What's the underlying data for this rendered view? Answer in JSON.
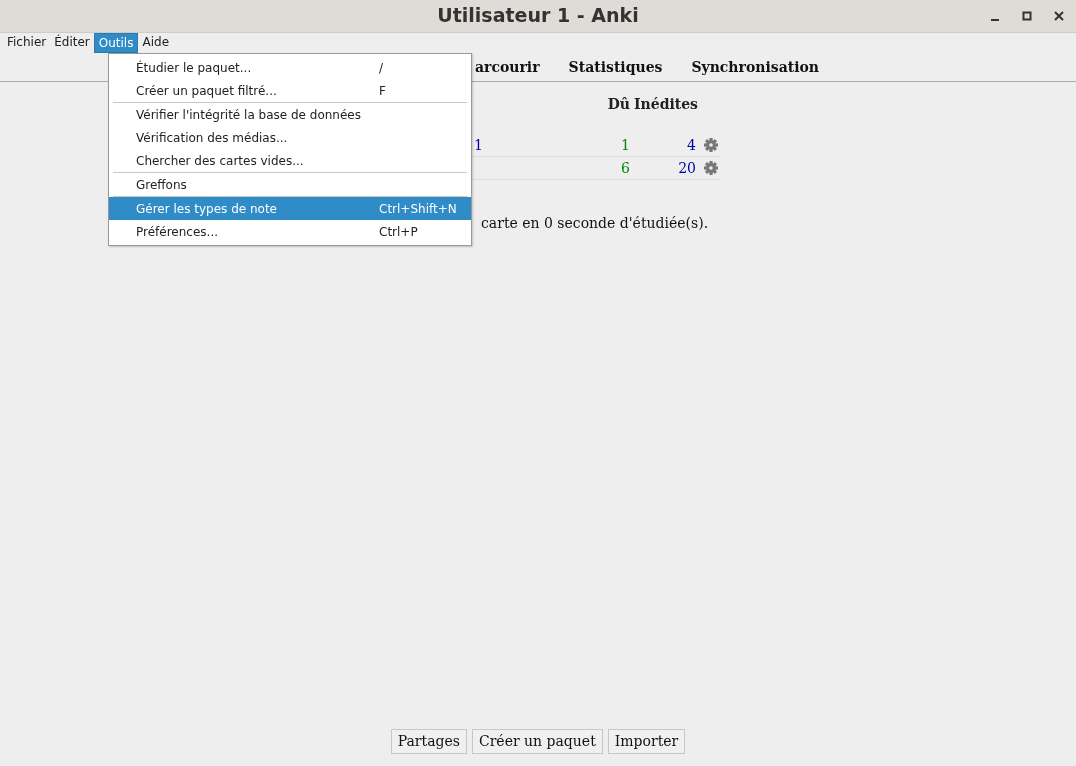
{
  "window": {
    "title": "Utilisateur 1 - Anki"
  },
  "menubar": [
    {
      "label": "Fichier",
      "selected": false
    },
    {
      "label": "Éditer",
      "selected": false
    },
    {
      "label": "Outils",
      "selected": true
    },
    {
      "label": "Aide",
      "selected": false
    }
  ],
  "menu": [
    {
      "kind": "item",
      "label": "Étudier le paquet...",
      "shortcut": "/",
      "selected": false
    },
    {
      "kind": "item",
      "label": "Créer un paquet filtré...",
      "shortcut": "F",
      "selected": false
    },
    {
      "kind": "separator"
    },
    {
      "kind": "item",
      "label": "Vérifier l'intégrité la base de données",
      "selected": false
    },
    {
      "kind": "item",
      "label": "Vérification des médias...",
      "selected": false
    },
    {
      "kind": "item",
      "label": "Chercher des cartes vides...",
      "selected": false
    },
    {
      "kind": "separator"
    },
    {
      "kind": "item",
      "label": "Greffons",
      "selected": false
    },
    {
      "kind": "separator"
    },
    {
      "kind": "item",
      "label": "Gérer les types de note",
      "shortcut": "Ctrl+Shift+N",
      "selected": true
    },
    {
      "kind": "item",
      "label": "Préférences...",
      "shortcut": "Ctrl+P",
      "selected": false
    }
  ],
  "toolbar": [
    "arcourir",
    "Statistiques",
    "Synchronisation"
  ],
  "deck_table": {
    "columns": [
      "Dû",
      "Inédites"
    ],
    "rows": [
      {
        "name": "1",
        "due": "1",
        "new": "4"
      },
      {
        "due": "6",
        "new": "20"
      }
    ]
  },
  "study_summary": "carte en 0 seconde d'étudiée(s).",
  "bottom_buttons": [
    "Partages",
    "Créer un paquet",
    "Importer"
  ]
}
